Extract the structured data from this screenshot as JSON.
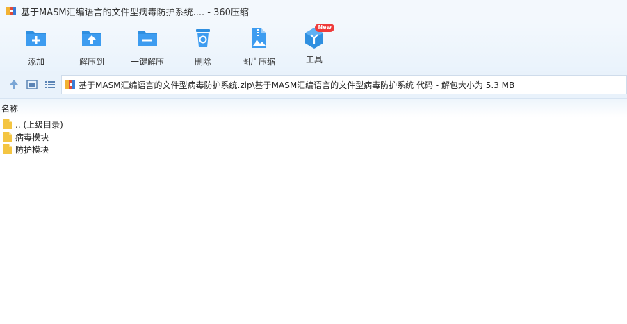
{
  "window": {
    "title": "基于MASM汇编语言的文件型病毒防护系统.... - 360压缩"
  },
  "toolbar": {
    "items": [
      {
        "label": "添加",
        "icon": "add-folder-icon"
      },
      {
        "label": "解压到",
        "icon": "extract-to-icon"
      },
      {
        "label": "一键解压",
        "icon": "one-click-extract-icon"
      },
      {
        "label": "删除",
        "icon": "recycle-bin-icon"
      },
      {
        "label": "图片压缩",
        "icon": "image-compress-icon"
      },
      {
        "label": "工具",
        "icon": "tools-hexagon-icon",
        "badge": "New"
      }
    ]
  },
  "navbar": {
    "path": "基于MASM汇编语言的文件型病毒防护系统.zip\\基于MASM汇编语言的文件型病毒防护系统 代码 - 解包大小为 5.3 MB"
  },
  "list": {
    "column_name": "名称",
    "rows": [
      {
        "name": ".. (上级目录)"
      },
      {
        "name": "病毒模块"
      },
      {
        "name": "防护模块"
      }
    ]
  },
  "colors": {
    "accent": "#2f8fe0",
    "folder": "#f4c542",
    "badge": "#ef3b3b"
  }
}
